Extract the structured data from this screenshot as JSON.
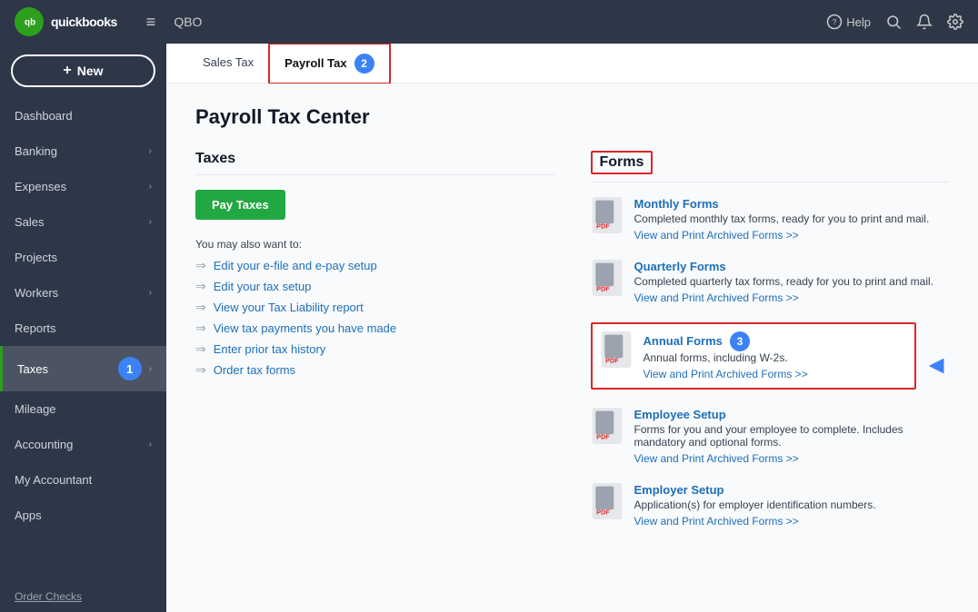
{
  "header": {
    "logo_text": "quickbooks",
    "qbo_label": "QBO",
    "help_label": "Help",
    "hamburger_icon": "≡"
  },
  "new_button": {
    "label": "New",
    "plus": "+"
  },
  "sidebar": {
    "items": [
      {
        "id": "dashboard",
        "label": "Dashboard",
        "has_chevron": false
      },
      {
        "id": "banking",
        "label": "Banking",
        "has_chevron": true
      },
      {
        "id": "expenses",
        "label": "Expenses",
        "has_chevron": true
      },
      {
        "id": "sales",
        "label": "Sales",
        "has_chevron": true
      },
      {
        "id": "projects",
        "label": "Projects",
        "has_chevron": false
      },
      {
        "id": "workers",
        "label": "Workers",
        "has_chevron": true
      },
      {
        "id": "reports",
        "label": "Reports",
        "has_chevron": false
      },
      {
        "id": "taxes",
        "label": "Taxes",
        "has_chevron": true,
        "active": true
      },
      {
        "id": "mileage",
        "label": "Mileage",
        "has_chevron": false
      },
      {
        "id": "accounting",
        "label": "Accounting",
        "has_chevron": true
      },
      {
        "id": "my_accountant",
        "label": "My Accountant",
        "has_chevron": false
      },
      {
        "id": "apps",
        "label": "Apps",
        "has_chevron": false
      }
    ],
    "order_checks_label": "Order Checks"
  },
  "tabs": [
    {
      "id": "sales_tax",
      "label": "Sales Tax",
      "active": false
    },
    {
      "id": "payroll_tax",
      "label": "Payroll Tax",
      "active": true,
      "highlighted": true
    }
  ],
  "page": {
    "title": "Payroll Tax Center",
    "taxes_section": {
      "title": "Taxes",
      "pay_taxes_btn": "Pay Taxes",
      "also_want_label": "You may also want to:",
      "links": [
        {
          "id": "edit-efile",
          "text": "Edit your e-file and e-pay setup"
        },
        {
          "id": "edit-tax",
          "text": "Edit your tax setup"
        },
        {
          "id": "view-liability",
          "text": "View your Tax Liability report"
        },
        {
          "id": "view-payments",
          "text": "View tax payments you have made"
        },
        {
          "id": "enter-prior",
          "text": "Enter prior tax history"
        },
        {
          "id": "order-forms",
          "text": "Order tax forms"
        }
      ]
    },
    "forms_section": {
      "title": "Forms",
      "items": [
        {
          "id": "monthly",
          "name": "Monthly Forms",
          "desc": "Completed monthly tax forms, ready for you to print and mail.",
          "link": "View and Print Archived Forms >>",
          "highlighted": false
        },
        {
          "id": "quarterly",
          "name": "Quarterly Forms",
          "desc": "Completed quarterly tax forms, ready for you to print and mail.",
          "link": "View and Print Archived Forms >>",
          "highlighted": false
        },
        {
          "id": "annual",
          "name": "Annual Forms",
          "desc": "Annual forms, including W-2s.",
          "link": "View and Print Archived Forms >>",
          "highlighted": true
        },
        {
          "id": "employee-setup",
          "name": "Employee Setup",
          "desc": "Forms for you and your employee to complete. Includes mandatory and optional forms.",
          "link": "View and Print Archived Forms >>",
          "highlighted": false
        },
        {
          "id": "employer-setup",
          "name": "Employer Setup",
          "desc": "Application(s) for employer identification numbers.",
          "link": "View and Print Archived Forms >>",
          "highlighted": false
        }
      ]
    }
  },
  "annotations": {
    "badge1": "1",
    "badge2": "2",
    "badge3": "3"
  }
}
